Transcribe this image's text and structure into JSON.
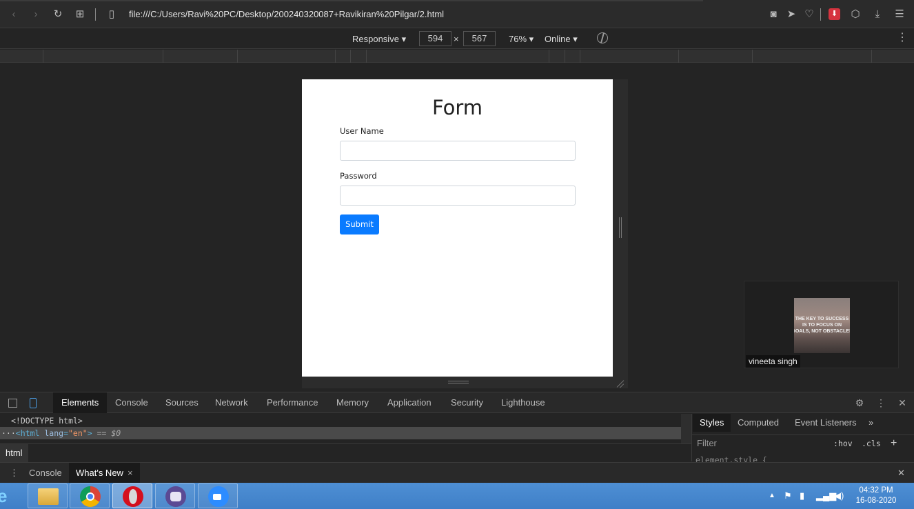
{
  "browser": {
    "url": "file:///C:/Users/Ravi%20PC/Desktop/200240320087+Ravikiran%20Pilgar/2.html",
    "back_icon": "back-arrow",
    "forward_icon": "forward-arrow",
    "reload_icon": "reload",
    "tabs_icon": "grid",
    "page_icon": "document",
    "right_icons": [
      "camera",
      "send",
      "heart",
      "download-red",
      "cube",
      "download",
      "menu"
    ]
  },
  "device_toolbar": {
    "mode": "Responsive",
    "width": "594",
    "height": "567",
    "times": "×",
    "zoom": "76%",
    "throttle": "Online"
  },
  "page": {
    "title": "Form",
    "username_label": "User Name",
    "password_label": "Password",
    "submit_label": "Submit",
    "accent_color": "#0a7bff"
  },
  "video_tile": {
    "thumb_text": [
      "THE KEY TO SUCCESS",
      "IS TO FOCUS ON",
      "GOALS, NOT OBSTACLES"
    ],
    "name": "vineeta singh"
  },
  "devtools": {
    "tabs": [
      "Elements",
      "Console",
      "Sources",
      "Network",
      "Performance",
      "Memory",
      "Application",
      "Security",
      "Lighthouse"
    ],
    "active_tab": "Elements",
    "dom": {
      "doctype": "<!DOCTYPE html>",
      "html_open_prefix": "<",
      "html_tag": "html",
      "html_attr": "lang",
      "html_attr_eq": "=",
      "html_attr_value": "\"en\"",
      "html_open_suffix": ">",
      "selected_marker": "== $0",
      "ellipsis": "···"
    },
    "breadcrumb": "html",
    "styles_tabs": [
      "Styles",
      "Computed",
      "Event Listeners"
    ],
    "more_tabs": "»",
    "filter_placeholder": "Filter",
    "hov": ":hov",
    "cls": ".cls",
    "plus": "+",
    "element_style": "element.style {",
    "drawer_tabs": [
      "Console",
      "What's New"
    ],
    "drawer_active": "What's New",
    "drawer_close": "×",
    "panel_close": "✕"
  },
  "taskbar": {
    "time": "04:32 PM",
    "date": "16-08-2020",
    "apps": [
      "Internet Explorer",
      "File Explorer",
      "Chrome",
      "Opera",
      "Gitbot",
      "Zoom"
    ]
  }
}
